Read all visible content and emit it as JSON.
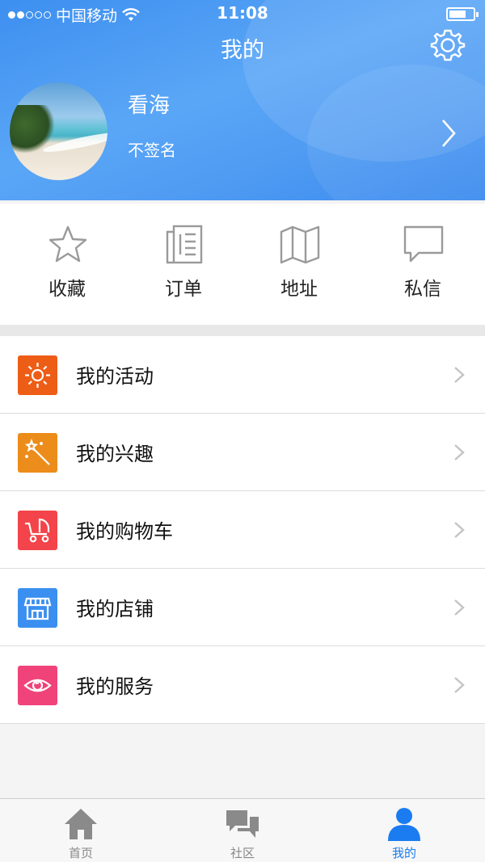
{
  "status_bar": {
    "carrier": "中国移动",
    "time": "11:08"
  },
  "header": {
    "title": "我的"
  },
  "profile": {
    "name": "看海",
    "signature": "不签名"
  },
  "quick_actions": [
    {
      "label": "收藏",
      "icon": "star-icon"
    },
    {
      "label": "订单",
      "icon": "document-icon"
    },
    {
      "label": "地址",
      "icon": "map-icon"
    },
    {
      "label": "私信",
      "icon": "message-icon"
    }
  ],
  "menu": [
    {
      "label": "我的活动",
      "icon": "sun-icon",
      "color": "#ee5d16"
    },
    {
      "label": "我的兴趣",
      "icon": "magic-wand-icon",
      "color": "#ec8c1a"
    },
    {
      "label": "我的购物车",
      "icon": "stroller-icon",
      "color": "#f2444a"
    },
    {
      "label": "我的店铺",
      "icon": "store-icon",
      "color": "#3a8ff0"
    },
    {
      "label": "我的服务",
      "icon": "eye-icon",
      "color": "#f0437a"
    }
  ],
  "tabs": [
    {
      "label": "首页",
      "icon": "home-icon",
      "active": false
    },
    {
      "label": "社区",
      "icon": "chat-icon",
      "active": false
    },
    {
      "label": "我的",
      "icon": "user-icon",
      "active": true
    }
  ],
  "colors": {
    "header_blue": "#4a9af3",
    "active_tab": "#1a7cf0",
    "inactive_tab": "#888888"
  }
}
